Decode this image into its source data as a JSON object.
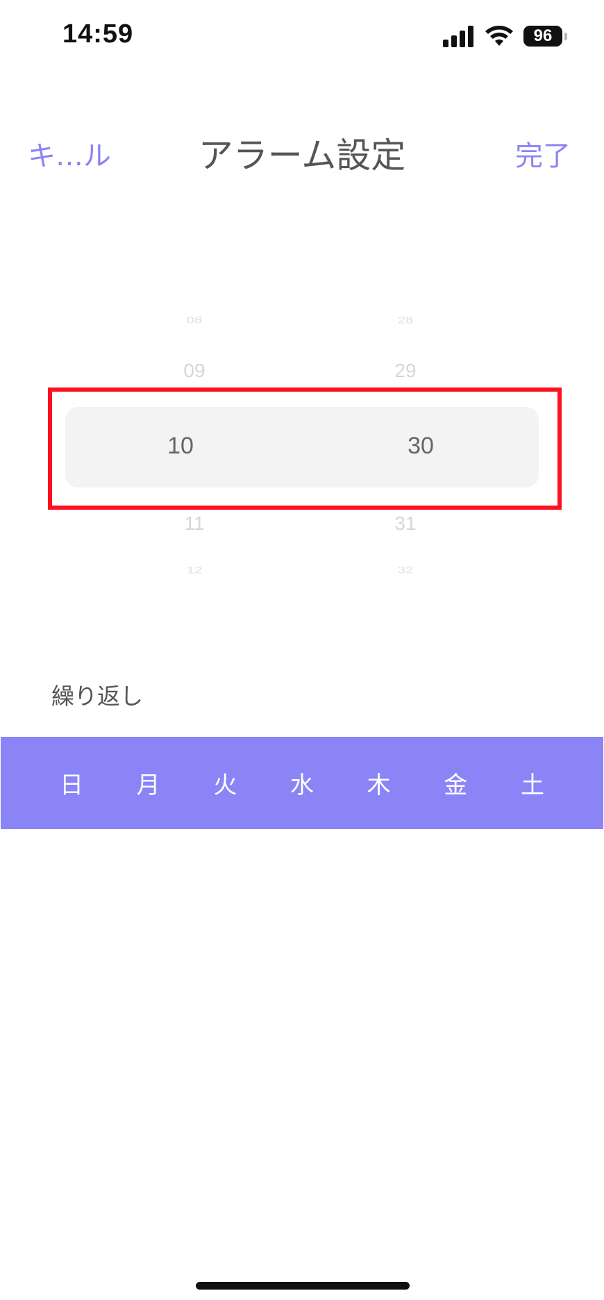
{
  "status_bar": {
    "time": "14:59",
    "battery_level": "96",
    "icons": [
      "signal-icon",
      "wifi-icon",
      "battery-icon"
    ]
  },
  "header": {
    "cancel_label": "キ…ル",
    "title": "アラーム設定",
    "done_label": "完了"
  },
  "picker": {
    "hours": [
      "08",
      "09",
      "10",
      "11",
      "12"
    ],
    "minutes": [
      "28",
      "29",
      "30",
      "31",
      "32"
    ],
    "selected_hour": "10",
    "selected_minute": "30"
  },
  "repeat": {
    "label": "繰り返し",
    "days": [
      "日",
      "月",
      "火",
      "水",
      "木",
      "金",
      "土"
    ]
  },
  "colors": {
    "accent": "#8b84f5",
    "weekday_bar": "#8b84f7",
    "highlight": "#ff1020"
  }
}
